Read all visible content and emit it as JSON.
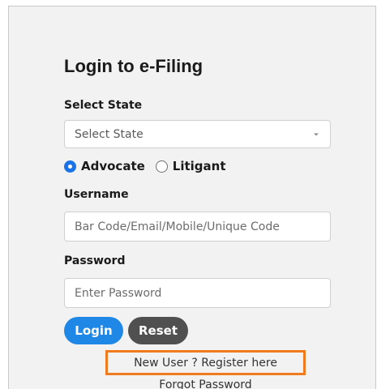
{
  "form": {
    "title": "Login to e-Filing",
    "state_label": "Select State",
    "state_selected": "Select State",
    "role_options": [
      {
        "label": "Advocate",
        "checked": true
      },
      {
        "label": "Litigant",
        "checked": false
      }
    ],
    "username_label": "Username",
    "username_placeholder": "Bar Code/Email/Mobile/Unique Code",
    "password_label": "Password",
    "password_placeholder": "Enter Password",
    "login_label": "Login",
    "reset_label": "Reset",
    "register_link": "New User ? Register here",
    "forgot_link": "Forgot Password"
  },
  "colors": {
    "primary": "#1f87e6",
    "reset": "#505050",
    "highlight": "#f07a1e",
    "panel_bg": "#f2f2f2"
  },
  "icons": {
    "select_arrow": "chevron-down-icon",
    "radio_checked": "radio-checked-icon",
    "radio_unchecked": "radio-unchecked-icon"
  }
}
